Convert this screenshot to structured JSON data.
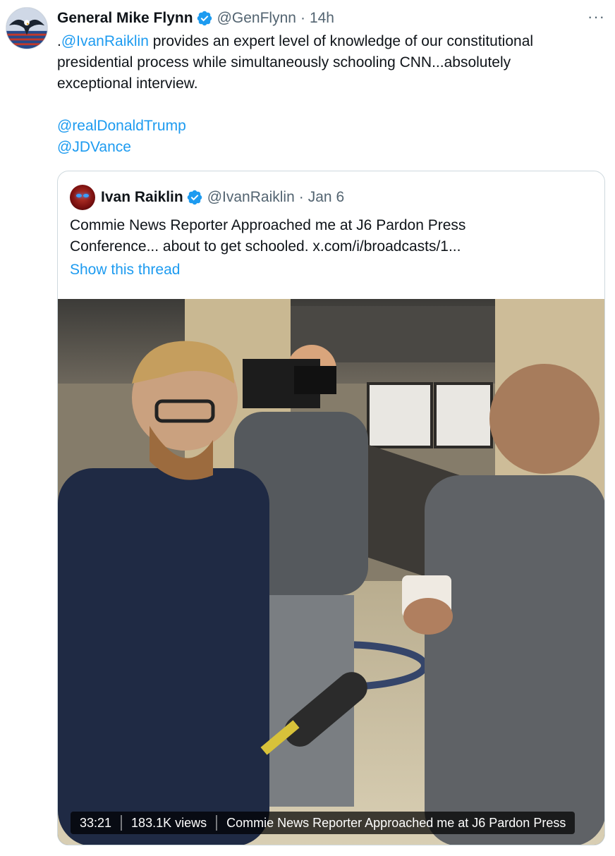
{
  "tweet": {
    "author_name": "General Mike Flynn",
    "author_handle": "@GenFlynn",
    "separator": "·",
    "time": "14h",
    "more_label": "···",
    "text_line1_prefix": ".",
    "text_line1_mention": "@IvanRaiklin",
    "text_line1_rest": " provides an expert level of knowledge of our constitutional",
    "text_line2": "presidential process while simultaneously schooling CNN...absolutely",
    "text_line3": "exceptional interview.",
    "mention_1": "@realDonaldTrump",
    "mention_2": "@JDVance",
    "avatar_icon": "eagle-flag-avatar-icon",
    "verified_color": "#1d9bf0"
  },
  "quote": {
    "author_name": "Ivan Raiklin",
    "author_handle": "@IvanRaiklin",
    "separator": "·",
    "date": "Jan 6",
    "text_line1": "Commie News Reporter Approached me at J6 Pardon Press",
    "text_line2": "Conference... about to get schooled. x.com/i/broadcasts/1...",
    "show_thread": "Show this thread"
  },
  "video": {
    "duration": "33:21",
    "views": "183.1K views",
    "title": "Commie News Reporter Approached me at J6 Pardon Press"
  },
  "colors": {
    "link": "#1d9bf0",
    "muted": "#536471",
    "text": "#0f1419",
    "border": "#cfd9de"
  }
}
